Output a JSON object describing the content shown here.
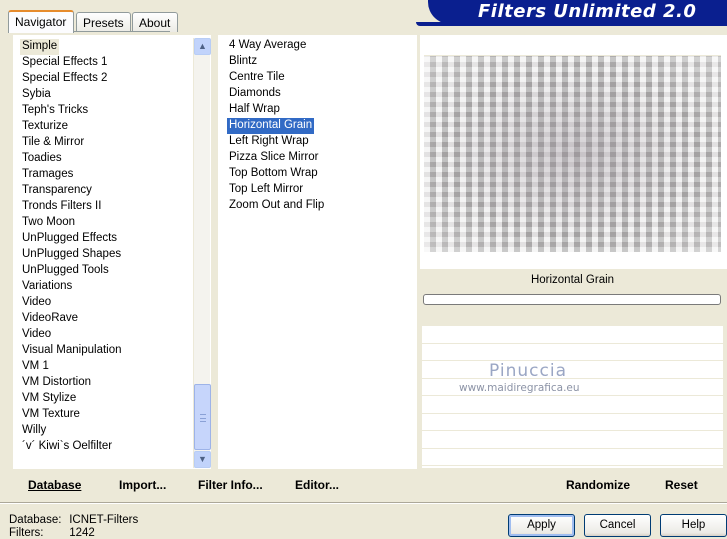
{
  "header": {
    "title": "Filters Unlimited 2.0"
  },
  "tabs": [
    {
      "label": "Navigator",
      "active": true
    },
    {
      "label": "Presets",
      "active": false
    },
    {
      "label": "About",
      "active": false
    }
  ],
  "categories": [
    "Simple",
    "Special Effects 1",
    "Special Effects 2",
    "Sybia",
    "Teph's Tricks",
    "Texturize",
    "Tile & Mirror",
    "Toadies",
    "Tramages",
    "Transparency",
    "Tronds Filters II",
    "Two Moon",
    "UnPlugged Effects",
    "UnPlugged Shapes",
    "UnPlugged Tools",
    "Variations",
    "Video",
    "VideoRave",
    "Video",
    "Visual Manipulation",
    "VM 1",
    "VM Distortion",
    "VM Stylize",
    "VM Texture",
    "Willy",
    "´v´ Kiwi`s Oelfilter"
  ],
  "selected_category": "Simple",
  "filters": [
    "4 Way Average",
    "Blintz",
    "Centre Tile",
    "Diamonds",
    "Half Wrap",
    "Horizontal Grain",
    "Left Right Wrap",
    "Pizza Slice Mirror",
    "Top Bottom Wrap",
    "Top Left Mirror",
    "Zoom Out and Flip"
  ],
  "selected_filter": "Horizontal Grain",
  "preview": {
    "filter_title": "Horizontal Grain"
  },
  "watermark": {
    "name": "Pinuccia",
    "url": "www.maidiregrafica.eu"
  },
  "toolbar": {
    "database": "Database",
    "import": "Import...",
    "filter_info": "Filter Info...",
    "editor": "Editor...",
    "randomize": "Randomize",
    "reset": "Reset"
  },
  "status": {
    "database_label": "Database:",
    "database_value": "ICNET-Filters",
    "filters_label": "Filters:",
    "filters_value": "1242"
  },
  "buttons": {
    "apply": "Apply",
    "cancel": "Cancel",
    "help": "Help"
  },
  "colors": {
    "accent": "#0a1f8f",
    "selection": "#316ac5",
    "background": "#ece9d8"
  }
}
